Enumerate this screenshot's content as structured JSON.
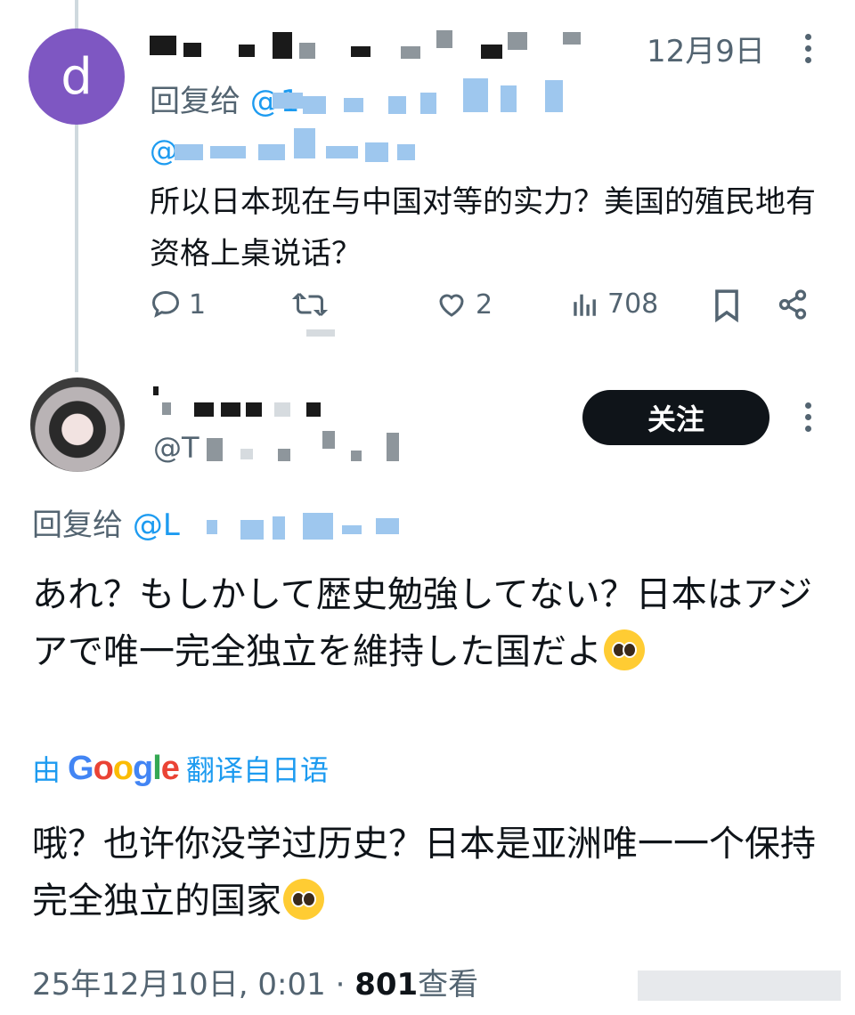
{
  "reply_tweet": {
    "avatar_letter": "d",
    "date": "12月9日",
    "reply_to_prefix": "回复给",
    "reply_to_handle": "@1",
    "second_handle_prefix": "@",
    "body": "所以日本现在与中国对等的实力？美国的殖民地有资格上桌说话？",
    "stats": {
      "replies": "1",
      "likes": "2",
      "views": "708"
    }
  },
  "main_tweet": {
    "handle": "@T",
    "follow_label": "关注",
    "reply_to_prefix": "回复给",
    "reply_to_handle": "@L",
    "original_text": "あれ？もしかして歴史勉強してない？日本はアジアで唯一完全独立を維持した国だよ",
    "translated_by_prefix": "由",
    "translated_by_suffix": "翻译自日语",
    "google_logo": [
      "G",
      "o",
      "o",
      "g",
      "l",
      "e"
    ],
    "translation": "哦？也许你没学过历史？日本是亚洲唯一一个保持完全独立的国家",
    "timestamp": "25年12月10日, 0:01 · ",
    "view_count": "801",
    "view_label": "查看"
  },
  "icons": [
    "reply-icon",
    "retweet-icon",
    "like-icon",
    "views-icon",
    "bookmark-icon",
    "share-icon",
    "more-icon",
    "smiling-tears-emoji"
  ],
  "colors": {
    "accent": "#1d9bf0",
    "muted": "#536471",
    "text": "#0f1419",
    "avatar_d": "#7e57c2"
  }
}
